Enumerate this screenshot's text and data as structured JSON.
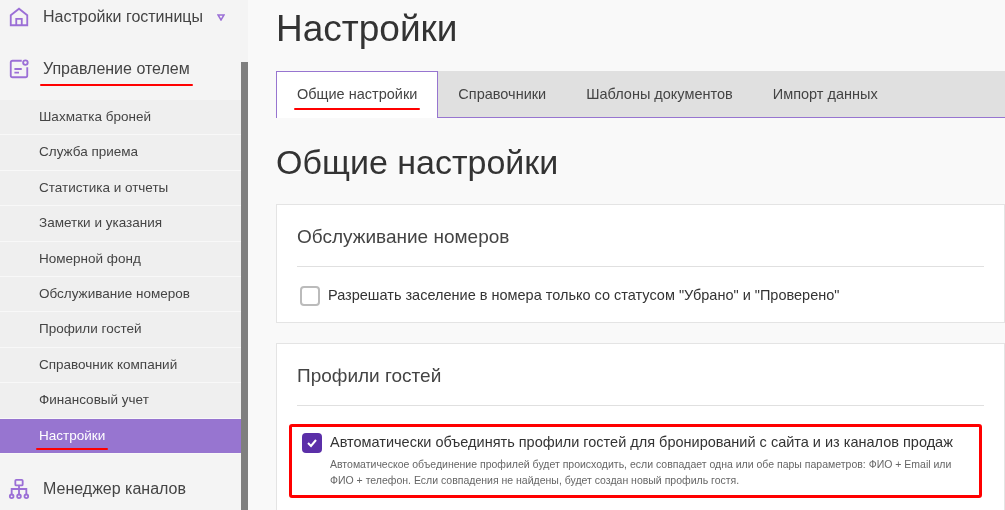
{
  "sidebar": {
    "items": [
      {
        "label": "Настройки гостиницы",
        "annotated": false
      },
      {
        "label": "Управление отелем",
        "annotated": true,
        "children": [
          {
            "label": "Шахматка броней",
            "selected": false,
            "annotated": false
          },
          {
            "label": "Служба приема",
            "selected": false,
            "annotated": false
          },
          {
            "label": "Статистика и отчеты",
            "selected": false,
            "annotated": false
          },
          {
            "label": "Заметки и указания",
            "selected": false,
            "annotated": false
          },
          {
            "label": "Номерной фонд",
            "selected": false,
            "annotated": false
          },
          {
            "label": "Обслуживание номеров",
            "selected": false,
            "annotated": false
          },
          {
            "label": "Профили гостей",
            "selected": false,
            "annotated": false
          },
          {
            "label": "Справочник компаний",
            "selected": false,
            "annotated": false
          },
          {
            "label": "Финансовый учет",
            "selected": false,
            "annotated": false
          },
          {
            "label": "Настройки",
            "selected": true,
            "annotated": true
          }
        ]
      },
      {
        "label": "Менеджер каналов",
        "annotated": false
      }
    ]
  },
  "page_title": "Настройки",
  "tabs": [
    {
      "label": "Общие настройки",
      "selected": true,
      "annotated": true
    },
    {
      "label": "Справочники",
      "selected": false,
      "annotated": false
    },
    {
      "label": "Шаблоны документов",
      "selected": false,
      "annotated": false
    },
    {
      "label": "Импорт данных",
      "selected": false,
      "annotated": false
    }
  ],
  "section_title": "Общие настройки",
  "cards": [
    {
      "title": "Обслуживание номеров",
      "options": [
        {
          "label": "Разрешать заселение в номера только со статусом \"Убрано\" и \"Проверено\"",
          "checked": false,
          "annotated": false
        }
      ]
    },
    {
      "title": "Профили гостей",
      "options": [
        {
          "label": "Автоматически объединять профили гостей для бронирований с сайта и из каналов продаж",
          "description": "Автоматическое объединение профилей будет происходить, если совпадает одна или обе пары параметров: ФИО + Email или ФИО + телефон. Если совпадения не найдены, будет создан новый профиль гостя.",
          "checked": true,
          "annotated": true
        }
      ]
    }
  ]
}
